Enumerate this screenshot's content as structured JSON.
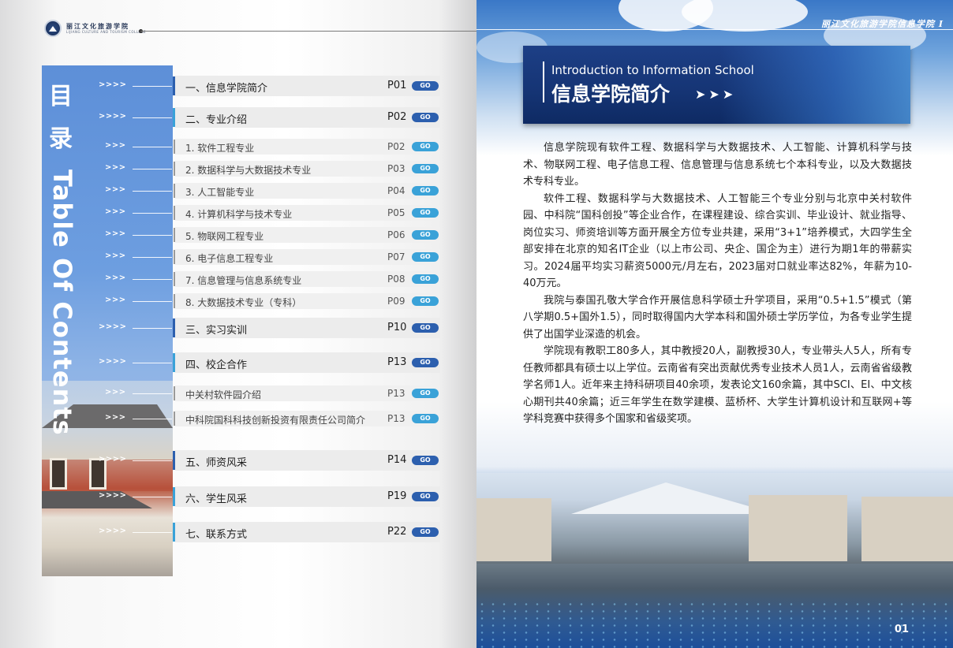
{
  "left": {
    "logo": {
      "cn": "丽江文化旅游学院",
      "en": "LIJIANG CULTURE AND TOURISM COLLEGE"
    },
    "toc_title_cn": "目  录",
    "toc_title_en": "Table Of Contents",
    "go_label": "GO",
    "arrows_main": ">>>>",
    "arrows_sub": ">>>",
    "rows": [
      {
        "label": "一、信息学院简介",
        "page": "P01"
      },
      {
        "label": "二、专业介绍",
        "page": "P02"
      },
      {
        "label": "1. 软件工程专业",
        "page": "P02"
      },
      {
        "label": "2. 数据科学与大数据技术专业",
        "page": "P03"
      },
      {
        "label": "3. 人工智能专业",
        "page": "P04"
      },
      {
        "label": "4. 计算机科学与技术专业",
        "page": "P05"
      },
      {
        "label": "5. 物联网工程专业",
        "page": "P06"
      },
      {
        "label": "6. 电子信息工程专业",
        "page": "P07"
      },
      {
        "label": "7. 信息管理与信息系统专业",
        "page": "P08"
      },
      {
        "label": "8. 大数据技术专业（专科）",
        "page": "P09"
      },
      {
        "label": "三、实习实训",
        "page": "P10"
      },
      {
        "label": "四、校企合作",
        "page": "P13"
      },
      {
        "label": "中关村软件园介绍",
        "page": "P13"
      },
      {
        "label": "中科院国科科技创新投资有限责任公司简介",
        "page": "P13"
      },
      {
        "label": "五、师资风采",
        "page": "P14"
      },
      {
        "label": "六、学生风采",
        "page": "P19"
      },
      {
        "label": "七、联系方式",
        "page": "P22"
      }
    ]
  },
  "right": {
    "slogan": "丽江文化旅游学院信息学院 I",
    "title_en": "Introduction to Information School",
    "title_cn": "信息学院简介",
    "paragraphs": [
      "信息学院现有软件工程、数据科学与大数据技术、人工智能、计算机科学与技术、物联网工程、电子信息工程、信息管理与信息系统七个本科专业，以及大数据技术专科专业。",
      "软件工程、数据科学与大数据技术、人工智能三个专业分别与北京中关村软件园、中科院“国科创投”等企业合作，在课程建设、综合实训、毕业设计、就业指导、岗位实习、师资培训等方面开展全方位专业共建，采用“3+1”培养模式，大四学生全部安排在北京的知名IT企业（以上市公司、央企、国企为主）进行为期1年的带薪实习。2024届平均实习薪资5000元/月左右，2023届对口就业率达82%，年薪为10-40万元。",
      "我院与泰国孔敬大学合作开展信息科学硕士升学项目，采用“0.5+1.5”模式（第八学期0.5+国外1.5），同时取得国内大学本科和国外硕士学历学位，为各专业学生提供了出国学业深造的机会。",
      "学院现有教职工80多人，其中教授20人，副教授30人，专业带头人5人，所有专任教师都具有硕士以上学位。云南省有突出贡献优秀专业技术人员1人，云南省省级教学名师1人。近年来主持科研项目40余项，发表论文160余篇，其中SCI、EI、中文核心期刊共40余篇；近三年学生在数学建模、蓝桥杯、大学生计算机设计和互联网+等学科竞赛中获得多个国家和省级奖项。"
    ],
    "page_number": "01"
  },
  "colors": {
    "accent_dark": "#2c5fae",
    "accent_light": "#3aa2d8",
    "title_bg": "#1d3f86"
  }
}
